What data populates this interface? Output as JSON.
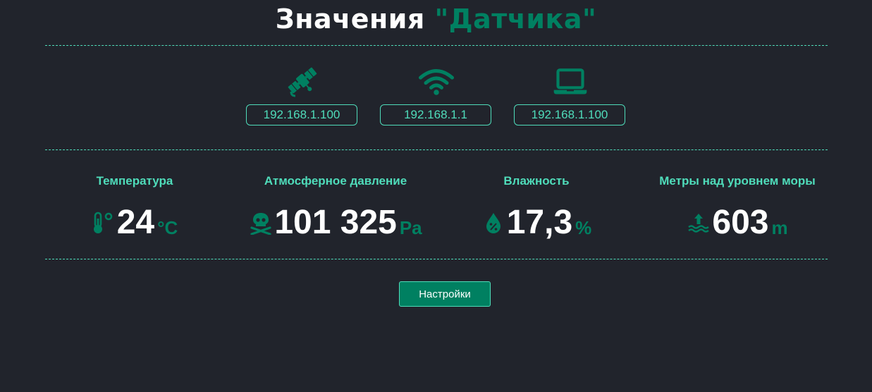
{
  "header": {
    "title_prefix": "Значения",
    "title_accent": "\"Датчика\""
  },
  "network": [
    {
      "icon": "satellite-icon",
      "ip": "192.168.1.100"
    },
    {
      "icon": "wifi-icon",
      "ip": "192.168.1.1"
    },
    {
      "icon": "laptop-icon",
      "ip": "192.168.1.100"
    }
  ],
  "metrics": [
    {
      "label": "Температура",
      "icon": "thermometer-icon",
      "value": "24",
      "unit": "°C"
    },
    {
      "label": "Атмосферное давление",
      "icon": "skull-crossbones-icon",
      "value": "101 325",
      "unit": "Pa"
    },
    {
      "label": "Влажность",
      "icon": "humidity-drop-icon",
      "value": "17,3",
      "unit": "%"
    },
    {
      "label": "Метры над уровнем моры",
      "icon": "water-level-up-icon",
      "value": "603",
      "unit": "m"
    }
  ],
  "actions": {
    "settings_label": "Настройки"
  },
  "colors": {
    "background": "#21242c",
    "accent": "#008061",
    "highlight": "#4fdcba",
    "text": "#ffffff"
  }
}
